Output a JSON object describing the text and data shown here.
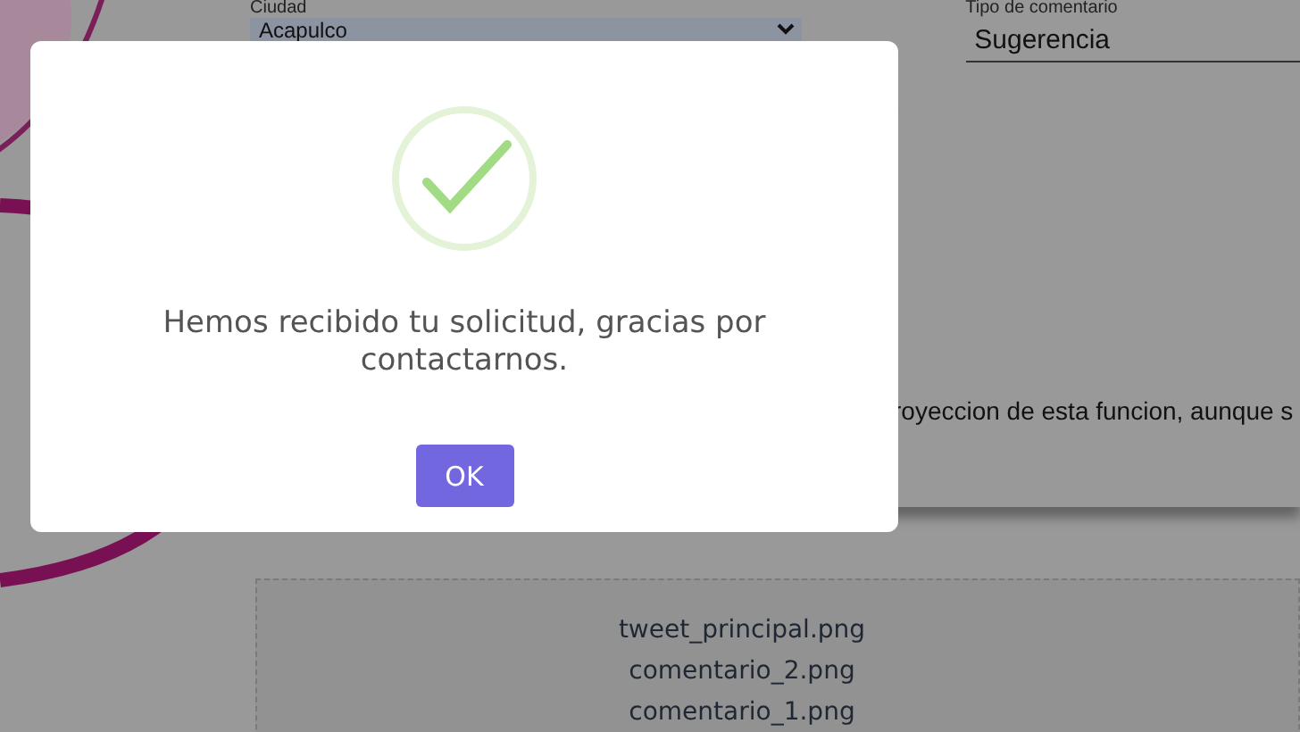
{
  "form": {
    "fields": [
      {
        "kind": "select",
        "label": "Ciudad",
        "value": "Acapulco"
      },
      {
        "kind": "text",
        "label": "Tipo de comentario",
        "value": "Sugerencia"
      }
    ],
    "comment_text": "royeccion de esta funcion, aunque s",
    "attachments": [
      "tweet_principal.png",
      "comentario_2.png",
      "comentario_1.png"
    ]
  },
  "dialog": {
    "message": "Hemos recibido tu solicitud, gracias por contactarnos.",
    "buttons": [
      "OK"
    ]
  }
}
